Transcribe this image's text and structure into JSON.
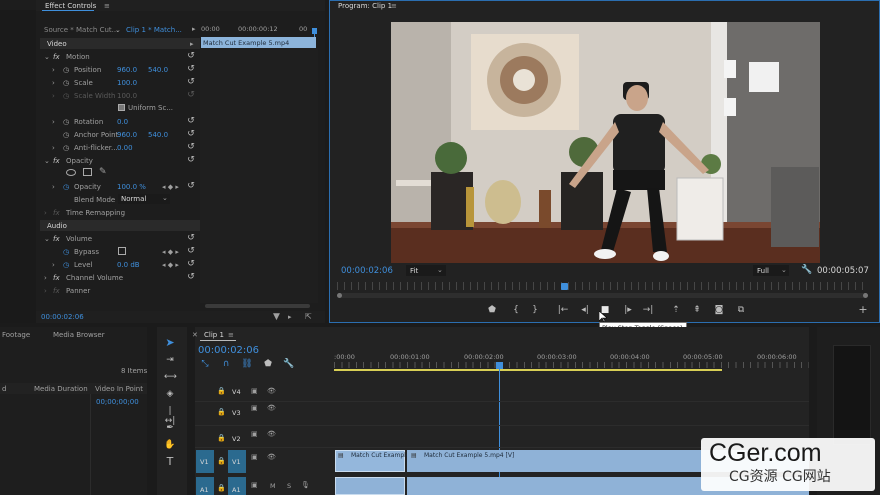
{
  "effect_controls": {
    "tab_title": "Effect Controls",
    "source_label": "Source * Match Cut...",
    "clip_label": "Clip 1 * Match...",
    "ruler": [
      "00:00",
      "00:00:00:12",
      "00"
    ],
    "clip_bar": "Match Cut Example 5.mp4",
    "video_header": "Video",
    "motion": "Motion",
    "position_label": "Position",
    "position_x": "960.0",
    "position_y": "540.0",
    "scale_label": "Scale",
    "scale_value": "100.0",
    "scale_width_label": "Scale Width",
    "scale_width_value": "100.0",
    "uniform_label": "Uniform Sc...",
    "rotation_label": "Rotation",
    "rotation_value": "0.0",
    "anchor_label": "Anchor Point",
    "anchor_x": "960.0",
    "anchor_y": "540.0",
    "flicker_label": "Anti-flicker...",
    "flicker_value": "0.00",
    "opacity": "Opacity",
    "opacity_label": "Opacity",
    "opacity_value": "100.0 %",
    "blend_label": "Blend Mode",
    "blend_value": "Normal",
    "time_remap": "Time Remapping",
    "audio_header": "Audio",
    "volume": "Volume",
    "bypass_label": "Bypass",
    "level_label": "Level",
    "level_value": "0.0 dB",
    "channel_volume": "Channel Volume",
    "panner": "Panner",
    "timecode": "00:00:02:06"
  },
  "program": {
    "tab_title": "Program: Clip 1",
    "timecode_left": "00:00:02:06",
    "fit": "Fit",
    "full": "Full",
    "timecode_right": "00:00:05:07",
    "tooltip": "Play-Stop Toggle (Space)"
  },
  "project": {
    "tab_footage": "Footage",
    "tab_media_browser": "Media Browser",
    "items_count": "8 Items",
    "col_d": "d",
    "col_duration": "Media Duration",
    "col_in_point": "Video In Point",
    "row_in_point": "00;00;00;00"
  },
  "timeline": {
    "tab_title": "Clip 1",
    "timecode": "00:00:02:06",
    "ruler": [
      ":00:00",
      "00:00:01:00",
      "00:00:02:00",
      "00:00:03:00",
      "00:00:04:00",
      "00:00:05:00",
      "00:00:06:00"
    ],
    "tracks": [
      {
        "src": "",
        "name": "V4"
      },
      {
        "src": "",
        "name": "V3"
      },
      {
        "src": "",
        "name": "V2"
      },
      {
        "src": "V1",
        "name": "V1"
      },
      {
        "src": "A1",
        "name": "A1"
      }
    ],
    "clip1": "Match Cut Example",
    "clip2": "Match Cut Example 5.mp4 [V]"
  },
  "watermark": {
    "logo": "CGer.com",
    "sub": "CG资源 CG网站"
  }
}
